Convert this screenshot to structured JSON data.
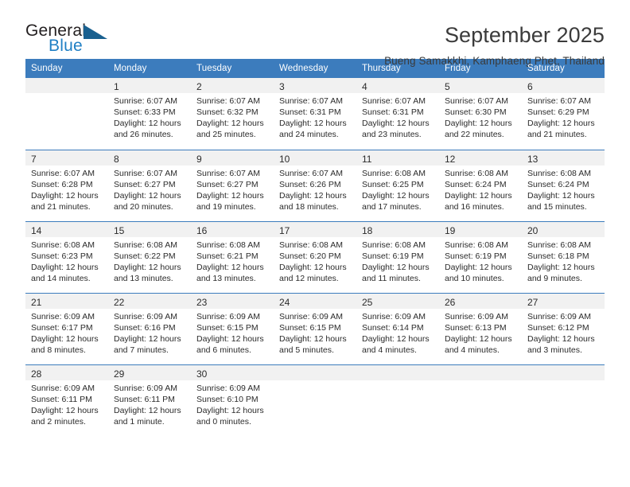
{
  "brand": {
    "name_part1": "General",
    "name_part2": "Blue",
    "accent_color": "#1f7fc4",
    "triangle_color": "#19608f"
  },
  "header": {
    "title": "September 2025",
    "subtitle": "Bueng Samakkhi, Kamphaeng Phet, Thailand"
  },
  "calendar": {
    "header_bg": "#3c7cbd",
    "numstrip_bg": "#f1f1f1",
    "labels": {
      "sunrise": "Sunrise:",
      "sunset": "Sunset:",
      "daylight": "Daylight:"
    },
    "weekdays": [
      "Sunday",
      "Monday",
      "Tuesday",
      "Wednesday",
      "Thursday",
      "Friday",
      "Saturday"
    ],
    "weeks": [
      [
        {
          "day": "",
          "sunrise": "",
          "sunset": "",
          "daylight_line1": "",
          "daylight_line2": ""
        },
        {
          "day": "1",
          "sunrise": "Sunrise: 6:07 AM",
          "sunset": "Sunset: 6:33 PM",
          "daylight_line1": "Daylight: 12 hours",
          "daylight_line2": "and 26 minutes."
        },
        {
          "day": "2",
          "sunrise": "Sunrise: 6:07 AM",
          "sunset": "Sunset: 6:32 PM",
          "daylight_line1": "Daylight: 12 hours",
          "daylight_line2": "and 25 minutes."
        },
        {
          "day": "3",
          "sunrise": "Sunrise: 6:07 AM",
          "sunset": "Sunset: 6:31 PM",
          "daylight_line1": "Daylight: 12 hours",
          "daylight_line2": "and 24 minutes."
        },
        {
          "day": "4",
          "sunrise": "Sunrise: 6:07 AM",
          "sunset": "Sunset: 6:31 PM",
          "daylight_line1": "Daylight: 12 hours",
          "daylight_line2": "and 23 minutes."
        },
        {
          "day": "5",
          "sunrise": "Sunrise: 6:07 AM",
          "sunset": "Sunset: 6:30 PM",
          "daylight_line1": "Daylight: 12 hours",
          "daylight_line2": "and 22 minutes."
        },
        {
          "day": "6",
          "sunrise": "Sunrise: 6:07 AM",
          "sunset": "Sunset: 6:29 PM",
          "daylight_line1": "Daylight: 12 hours",
          "daylight_line2": "and 21 minutes."
        }
      ],
      [
        {
          "day": "7",
          "sunrise": "Sunrise: 6:07 AM",
          "sunset": "Sunset: 6:28 PM",
          "daylight_line1": "Daylight: 12 hours",
          "daylight_line2": "and 21 minutes."
        },
        {
          "day": "8",
          "sunrise": "Sunrise: 6:07 AM",
          "sunset": "Sunset: 6:27 PM",
          "daylight_line1": "Daylight: 12 hours",
          "daylight_line2": "and 20 minutes."
        },
        {
          "day": "9",
          "sunrise": "Sunrise: 6:07 AM",
          "sunset": "Sunset: 6:27 PM",
          "daylight_line1": "Daylight: 12 hours",
          "daylight_line2": "and 19 minutes."
        },
        {
          "day": "10",
          "sunrise": "Sunrise: 6:07 AM",
          "sunset": "Sunset: 6:26 PM",
          "daylight_line1": "Daylight: 12 hours",
          "daylight_line2": "and 18 minutes."
        },
        {
          "day": "11",
          "sunrise": "Sunrise: 6:08 AM",
          "sunset": "Sunset: 6:25 PM",
          "daylight_line1": "Daylight: 12 hours",
          "daylight_line2": "and 17 minutes."
        },
        {
          "day": "12",
          "sunrise": "Sunrise: 6:08 AM",
          "sunset": "Sunset: 6:24 PM",
          "daylight_line1": "Daylight: 12 hours",
          "daylight_line2": "and 16 minutes."
        },
        {
          "day": "13",
          "sunrise": "Sunrise: 6:08 AM",
          "sunset": "Sunset: 6:24 PM",
          "daylight_line1": "Daylight: 12 hours",
          "daylight_line2": "and 15 minutes."
        }
      ],
      [
        {
          "day": "14",
          "sunrise": "Sunrise: 6:08 AM",
          "sunset": "Sunset: 6:23 PM",
          "daylight_line1": "Daylight: 12 hours",
          "daylight_line2": "and 14 minutes."
        },
        {
          "day": "15",
          "sunrise": "Sunrise: 6:08 AM",
          "sunset": "Sunset: 6:22 PM",
          "daylight_line1": "Daylight: 12 hours",
          "daylight_line2": "and 13 minutes."
        },
        {
          "day": "16",
          "sunrise": "Sunrise: 6:08 AM",
          "sunset": "Sunset: 6:21 PM",
          "daylight_line1": "Daylight: 12 hours",
          "daylight_line2": "and 13 minutes."
        },
        {
          "day": "17",
          "sunrise": "Sunrise: 6:08 AM",
          "sunset": "Sunset: 6:20 PM",
          "daylight_line1": "Daylight: 12 hours",
          "daylight_line2": "and 12 minutes."
        },
        {
          "day": "18",
          "sunrise": "Sunrise: 6:08 AM",
          "sunset": "Sunset: 6:19 PM",
          "daylight_line1": "Daylight: 12 hours",
          "daylight_line2": "and 11 minutes."
        },
        {
          "day": "19",
          "sunrise": "Sunrise: 6:08 AM",
          "sunset": "Sunset: 6:19 PM",
          "daylight_line1": "Daylight: 12 hours",
          "daylight_line2": "and 10 minutes."
        },
        {
          "day": "20",
          "sunrise": "Sunrise: 6:08 AM",
          "sunset": "Sunset: 6:18 PM",
          "daylight_line1": "Daylight: 12 hours",
          "daylight_line2": "and 9 minutes."
        }
      ],
      [
        {
          "day": "21",
          "sunrise": "Sunrise: 6:09 AM",
          "sunset": "Sunset: 6:17 PM",
          "daylight_line1": "Daylight: 12 hours",
          "daylight_line2": "and 8 minutes."
        },
        {
          "day": "22",
          "sunrise": "Sunrise: 6:09 AM",
          "sunset": "Sunset: 6:16 PM",
          "daylight_line1": "Daylight: 12 hours",
          "daylight_line2": "and 7 minutes."
        },
        {
          "day": "23",
          "sunrise": "Sunrise: 6:09 AM",
          "sunset": "Sunset: 6:15 PM",
          "daylight_line1": "Daylight: 12 hours",
          "daylight_line2": "and 6 minutes."
        },
        {
          "day": "24",
          "sunrise": "Sunrise: 6:09 AM",
          "sunset": "Sunset: 6:15 PM",
          "daylight_line1": "Daylight: 12 hours",
          "daylight_line2": "and 5 minutes."
        },
        {
          "day": "25",
          "sunrise": "Sunrise: 6:09 AM",
          "sunset": "Sunset: 6:14 PM",
          "daylight_line1": "Daylight: 12 hours",
          "daylight_line2": "and 4 minutes."
        },
        {
          "day": "26",
          "sunrise": "Sunrise: 6:09 AM",
          "sunset": "Sunset: 6:13 PM",
          "daylight_line1": "Daylight: 12 hours",
          "daylight_line2": "and 4 minutes."
        },
        {
          "day": "27",
          "sunrise": "Sunrise: 6:09 AM",
          "sunset": "Sunset: 6:12 PM",
          "daylight_line1": "Daylight: 12 hours",
          "daylight_line2": "and 3 minutes."
        }
      ],
      [
        {
          "day": "28",
          "sunrise": "Sunrise: 6:09 AM",
          "sunset": "Sunset: 6:11 PM",
          "daylight_line1": "Daylight: 12 hours",
          "daylight_line2": "and 2 minutes."
        },
        {
          "day": "29",
          "sunrise": "Sunrise: 6:09 AM",
          "sunset": "Sunset: 6:11 PM",
          "daylight_line1": "Daylight: 12 hours",
          "daylight_line2": "and 1 minute."
        },
        {
          "day": "30",
          "sunrise": "Sunrise: 6:09 AM",
          "sunset": "Sunset: 6:10 PM",
          "daylight_line1": "Daylight: 12 hours",
          "daylight_line2": "and 0 minutes."
        },
        {
          "day": "",
          "sunrise": "",
          "sunset": "",
          "daylight_line1": "",
          "daylight_line2": ""
        },
        {
          "day": "",
          "sunrise": "",
          "sunset": "",
          "daylight_line1": "",
          "daylight_line2": ""
        },
        {
          "day": "",
          "sunrise": "",
          "sunset": "",
          "daylight_line1": "",
          "daylight_line2": ""
        },
        {
          "day": "",
          "sunrise": "",
          "sunset": "",
          "daylight_line1": "",
          "daylight_line2": ""
        }
      ]
    ]
  }
}
